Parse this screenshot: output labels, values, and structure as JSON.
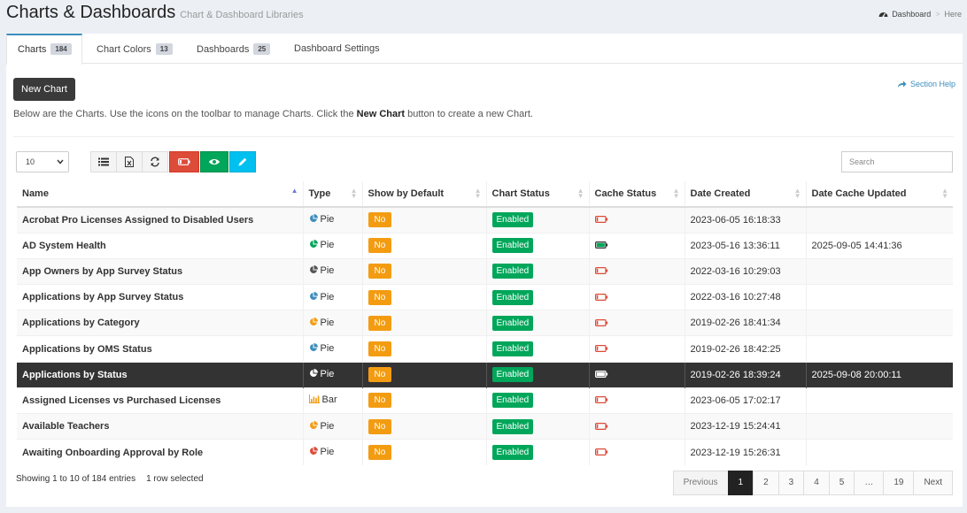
{
  "header": {
    "title": "Charts & Dashboards",
    "subtitle": "Chart & Dashboard Libraries",
    "breadcrumb": [
      "Dashboard",
      "Here"
    ]
  },
  "tabs": [
    {
      "label": "Charts",
      "count": "184"
    },
    {
      "label": "Chart Colors",
      "count": "13"
    },
    {
      "label": "Dashboards",
      "count": "25"
    },
    {
      "label": "Dashboard Settings",
      "count": ""
    }
  ],
  "toolbar": {
    "new_chart_label": "New Chart",
    "section_help_label": "Section Help",
    "intro_before": "Below are the Charts. Use the icons on the toolbar to manage Charts. Click the ",
    "intro_bold": "New Chart",
    "intro_after": " button to create a new Chart.",
    "page_length": "10",
    "search_placeholder": "Search"
  },
  "table": {
    "columns": [
      "Name",
      "Type",
      "Show by Default",
      "Chart Status",
      "Cache Status",
      "Date Created",
      "Date Cache Updated"
    ],
    "rows": [
      {
        "name": "Acrobat Pro Licenses Assigned to Disabled Users",
        "type": "Pie",
        "icon_color": "#3c8dbc",
        "show_default": "No",
        "status": "Enabled",
        "cache": "empty",
        "created": "2023-06-05 16:18:33",
        "cache_updated": ""
      },
      {
        "name": "AD System Health",
        "type": "Pie",
        "icon_color": "#00a65a",
        "show_default": "No",
        "status": "Enabled",
        "cache": "full",
        "created": "2023-05-16 13:36:11",
        "cache_updated": "2025-09-05 14:41:36"
      },
      {
        "name": "App Owners by App Survey Status",
        "type": "Pie",
        "icon_color": "#555555",
        "show_default": "No",
        "status": "Enabled",
        "cache": "empty",
        "created": "2022-03-16 10:29:03",
        "cache_updated": ""
      },
      {
        "name": "Applications by App Survey Status",
        "type": "Pie",
        "icon_color": "#3c8dbc",
        "show_default": "No",
        "status": "Enabled",
        "cache": "empty",
        "created": "2022-03-16 10:27:48",
        "cache_updated": ""
      },
      {
        "name": "Applications by Category",
        "type": "Pie",
        "icon_color": "#f39c12",
        "show_default": "No",
        "status": "Enabled",
        "cache": "empty",
        "created": "2019-02-26 18:41:34",
        "cache_updated": ""
      },
      {
        "name": "Applications by OMS Status",
        "type": "Pie",
        "icon_color": "#3c8dbc",
        "show_default": "No",
        "status": "Enabled",
        "cache": "empty",
        "created": "2019-02-26 18:42:25",
        "cache_updated": ""
      },
      {
        "name": "Applications by Status",
        "type": "Pie",
        "icon_color": "#ffffff",
        "show_default": "No",
        "status": "Enabled",
        "cache": "white",
        "created": "2019-02-26 18:39:24",
        "cache_updated": "2025-09-08 20:00:11",
        "selected": true
      },
      {
        "name": "Assigned Licenses vs Purchased Licenses",
        "type": "Bar",
        "icon_color": "#f39c12",
        "show_default": "No",
        "status": "Enabled",
        "cache": "empty",
        "created": "2023-06-05 17:02:17",
        "cache_updated": ""
      },
      {
        "name": "Available Teachers",
        "type": "Pie",
        "icon_color": "#f39c12",
        "show_default": "No",
        "status": "Enabled",
        "cache": "empty",
        "created": "2023-12-19 15:24:41",
        "cache_updated": ""
      },
      {
        "name": "Awaiting Onboarding Approval by Role",
        "type": "Pie",
        "icon_color": "#dd4b39",
        "show_default": "No",
        "status": "Enabled",
        "cache": "empty",
        "created": "2023-12-19 15:26:31",
        "cache_updated": ""
      }
    ]
  },
  "footer": {
    "info": "Showing 1 to 10 of 184 entries",
    "selected": "1 row selected",
    "pagination": [
      "Previous",
      "1",
      "2",
      "3",
      "4",
      "5",
      "…",
      "19",
      "Next"
    ]
  },
  "colors": {
    "accent": "#3c8dbc",
    "danger": "#dd4b39",
    "success": "#00a65a",
    "warning": "#f39c12",
    "info": "#00c0ef",
    "selected_row": "#333333"
  }
}
